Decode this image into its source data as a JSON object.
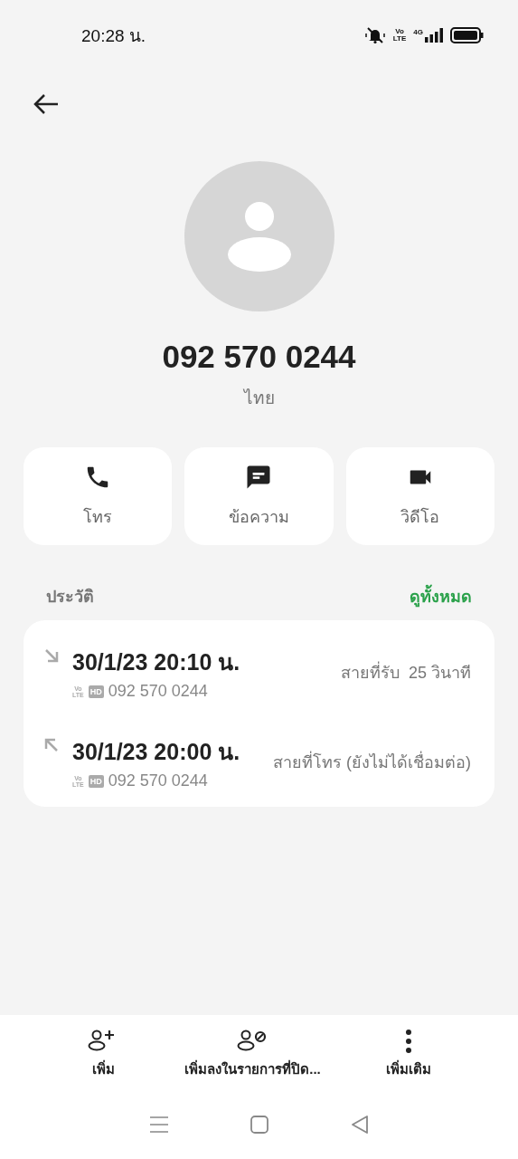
{
  "status_bar": {
    "time": "20:28 น.",
    "volte_top": "Vo",
    "volte_bottom": "LTE",
    "data": "4G"
  },
  "contact": {
    "number": "092 570 0244",
    "location": "ไทย"
  },
  "actions": [
    {
      "kind": "call",
      "label": "โทร"
    },
    {
      "kind": "message",
      "label": "ข้อความ"
    },
    {
      "kind": "video",
      "label": "วิดีโอ"
    }
  ],
  "history": {
    "title": "ประวัติ",
    "see_all": "ดูทั้งหมด",
    "calls": [
      {
        "kind": "incoming",
        "time": "30/1/23 20:10 น.",
        "volte_top": "Vo",
        "volte_bottom": "LTE",
        "quality": "HD",
        "number": "092 570 0244",
        "status": "สายที่รับ  25 วินาที"
      },
      {
        "kind": "outgoing",
        "time": "30/1/23 20:00 น.",
        "volte_top": "Vo",
        "volte_bottom": "LTE",
        "quality": "HD",
        "number": "092 570 0244",
        "status": "สายที่โทร (ยังไม่ได้เชื่อมต่อ)"
      }
    ]
  },
  "bottom_actions": [
    {
      "kind": "add",
      "label": "เพิ่ม"
    },
    {
      "kind": "block",
      "label": "เพิ่มลงในรายการที่ปิด..."
    },
    {
      "kind": "more",
      "label": "เพิ่มเติม"
    }
  ]
}
